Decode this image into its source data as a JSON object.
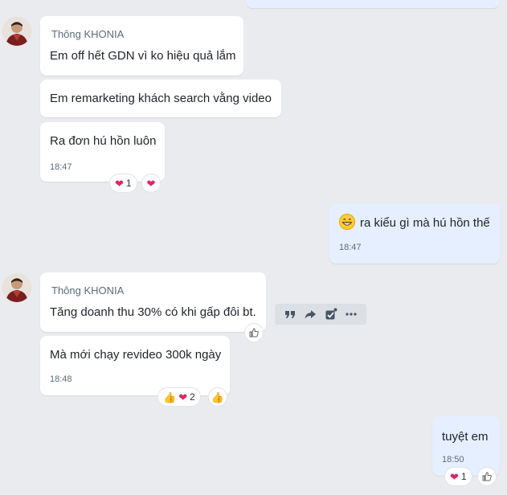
{
  "messages": [
    {
      "sender": "Thông KHONIA",
      "text": "Em off hết GDN vì ko hiệu quả lắm"
    },
    {
      "text": "Em remarketing khách search vằng video"
    },
    {
      "text": "Ra đơn hú hồn luôn",
      "time": "18:47",
      "reaction_count": "1"
    },
    {
      "text": "ra kiểu gì mà hú hồn thế",
      "time": "18:47",
      "emoji": "grinning-face"
    },
    {
      "sender": "Thông KHONIA",
      "text": "Tăng doanh thu 30% có khi gấp đôi bt."
    },
    {
      "text": "Mà mới chạy revideo 300k ngày",
      "time": "18:48",
      "reaction_count": "2"
    },
    {
      "text": "tuyệt em",
      "time": "18:50",
      "reaction_count": "1"
    }
  ],
  "action_icons": [
    "quote-icon",
    "forward-icon",
    "select-icon",
    "more-icon"
  ],
  "colors": {
    "background": "#e9ebee",
    "incoming": "#ffffff",
    "outgoing": "#e5efff",
    "heart": "#e0245e"
  }
}
